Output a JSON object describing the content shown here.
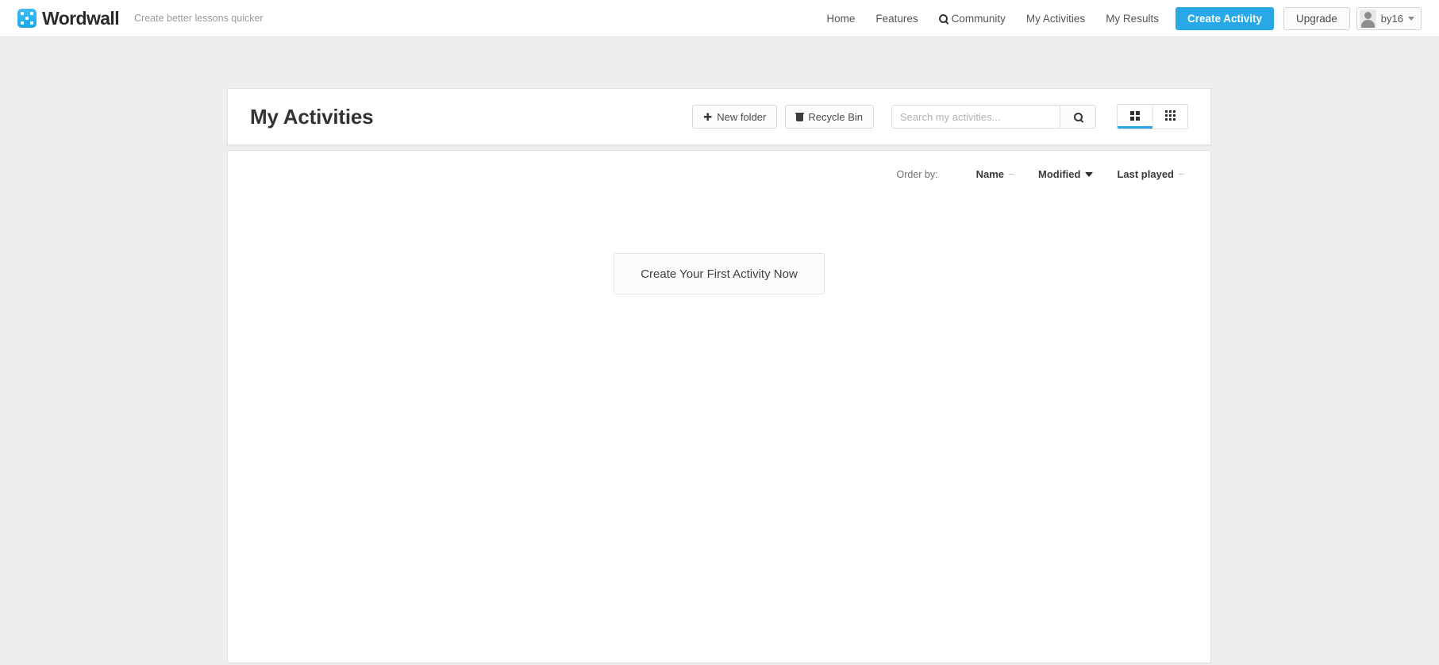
{
  "navbar": {
    "brand_name": "Wordwall",
    "brand_icon": "wordwall-logo-icon",
    "tagline": "Create better lessons quicker",
    "links": [
      {
        "label": "Home",
        "icon": null
      },
      {
        "label": "Features",
        "icon": null
      },
      {
        "label": "Community",
        "icon": "search-icon"
      },
      {
        "label": "My Activities",
        "icon": null
      },
      {
        "label": "My Results",
        "icon": null
      }
    ],
    "create_activity_label": "Create Activity",
    "upgrade_label": "Upgrade",
    "user_name": "by16",
    "user_caret_icon": "chevron-down-icon",
    "accent_color": "#29a8e8"
  },
  "page": {
    "title": "My Activities",
    "toolbar": {
      "new_folder_label": "New folder",
      "new_folder_icon": "plus-icon",
      "recycle_bin_label": "Recycle Bin",
      "recycle_bin_icon": "trash-icon",
      "search_value": "",
      "search_placeholder": "Search my activities...",
      "search_button_icon": "search-icon",
      "views": [
        {
          "name": "large-grid",
          "icon": "grid-2x2-icon",
          "active": true
        },
        {
          "name": "small-grid",
          "icon": "grid-3x3-icon",
          "active": false
        }
      ]
    },
    "order_by": {
      "label": "Order by:",
      "options": [
        {
          "label": "Name",
          "state": "inactive",
          "icon": "dash-icon"
        },
        {
          "label": "Modified",
          "state": "active",
          "icon": "caret-down-icon"
        },
        {
          "label": "Last played",
          "state": "inactive",
          "icon": "dash-icon"
        }
      ]
    },
    "empty_state": {
      "cta_label": "Create Your First Activity Now"
    }
  }
}
